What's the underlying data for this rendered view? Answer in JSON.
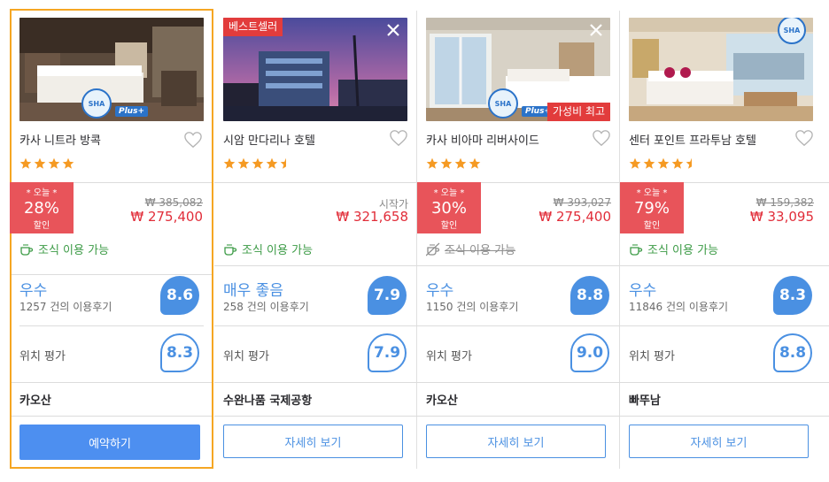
{
  "hotels": [
    {
      "name": "카사 니트라 방콕",
      "stars": 4,
      "deal": {
        "top": "* 오늘 *",
        "percent": "28%",
        "bottom": "할인"
      },
      "old_price": "₩ 385,082",
      "price": "₩ 275,400",
      "breakfast": "조식 이용 가능",
      "rating_label": "우수",
      "reviews": "1257 건의 이용후기",
      "score": "8.6",
      "location_label": "위치 평가",
      "location_score": "8.3",
      "area": "카오산",
      "button": "예약하기",
      "sha": "SHA",
      "sha_plus": "Plus+"
    },
    {
      "name": "시암 만다리나 호텔",
      "stars": 4.5,
      "badge": "베스트셀러",
      "from_label": "시작가",
      "price": "₩ 321,658",
      "breakfast": "조식 이용 가능",
      "rating_label": "매우 좋음",
      "reviews": "258 건의 이용후기",
      "score": "7.9",
      "location_label": "위치 평가",
      "location_score": "7.9",
      "area": "수완나품 국제공항",
      "button": "자세히 보기"
    },
    {
      "name": "카사 비아마 리버사이드",
      "stars": 4,
      "badge": "가성비 최고",
      "deal": {
        "top": "* 오늘 *",
        "percent": "30%",
        "bottom": "할인"
      },
      "old_price": "₩ 393,027",
      "price": "₩ 275,400",
      "breakfast": "조식 이용 가능",
      "rating_label": "우수",
      "reviews": "1150 건의 이용후기",
      "score": "8.8",
      "location_label": "위치 평가",
      "location_score": "9.0",
      "area": "카오산",
      "button": "자세히 보기",
      "sha": "SHA",
      "sha_plus": "Plus+"
    },
    {
      "name": "센터 포인트 프라투남 호텔",
      "stars": 4.5,
      "deal": {
        "top": "* 오늘 *",
        "percent": "79%",
        "bottom": "할인"
      },
      "old_price": "₩ 159,382",
      "price": "₩ 33,095",
      "breakfast": "조식 이용 가능",
      "rating_label": "우수",
      "reviews": "11846 건의 이용후기",
      "score": "8.3",
      "location_label": "위치 평가",
      "location_score": "8.8",
      "area": "빠뚜남",
      "button": "자세히 보기",
      "sha": "SHA"
    }
  ],
  "colors": {
    "accent_blue": "#4a90e2",
    "deal_red": "#e8545a",
    "price_red": "#e12d39",
    "star_orange": "#f59a23",
    "breakfast_green": "#3c9b46",
    "selected_border": "#f5a623"
  }
}
